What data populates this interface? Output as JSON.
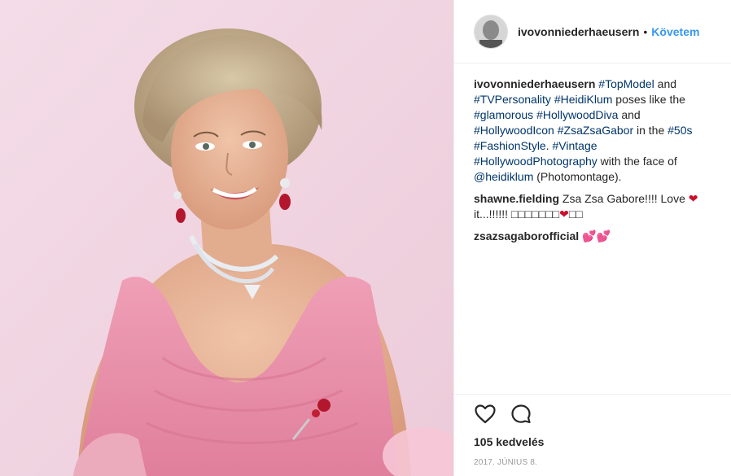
{
  "header": {
    "username": "ivovonniederhaeusern",
    "separator": "•",
    "follow_label": "Követem"
  },
  "caption": {
    "username": "ivovonniederhaeusern",
    "parts": [
      {
        "type": "tag",
        "text": "#TopModel"
      },
      {
        "type": "text",
        "text": " and "
      },
      {
        "type": "tag",
        "text": "#TVPersonality"
      },
      {
        "type": "text",
        "text": " "
      },
      {
        "type": "tag",
        "text": "#HeidiKlum"
      },
      {
        "type": "text",
        "text": " poses like the "
      },
      {
        "type": "tag",
        "text": "#glamorous"
      },
      {
        "type": "text",
        "text": " "
      },
      {
        "type": "tag",
        "text": "#HollywoodDiva"
      },
      {
        "type": "text",
        "text": " and "
      },
      {
        "type": "tag",
        "text": "#HollywoodIcon"
      },
      {
        "type": "text",
        "text": " "
      },
      {
        "type": "tag",
        "text": "#ZsaZsaGabor"
      },
      {
        "type": "text",
        "text": " in the "
      },
      {
        "type": "tag",
        "text": "#50s"
      },
      {
        "type": "text",
        "text": " "
      },
      {
        "type": "tag",
        "text": "#FashionStyle"
      },
      {
        "type": "text",
        "text": ". "
      },
      {
        "type": "tag",
        "text": "#Vintage"
      },
      {
        "type": "text",
        "text": " "
      },
      {
        "type": "tag",
        "text": "#HollywoodPhotography"
      },
      {
        "type": "text",
        "text": " with the face of "
      },
      {
        "type": "tag",
        "text": "@heidiklum"
      },
      {
        "type": "text",
        "text": " (Photomontage)."
      }
    ]
  },
  "comments": [
    {
      "username": "shawne.fielding",
      "text_before": "Zsa Zsa Gabore!!!! Love ",
      "heart": "❤",
      "text_after": " it...!!!!!! □□□□□□□",
      "heart2": "❤",
      "text_end": "□□"
    },
    {
      "username": "zsazsagaborofficial",
      "emoji": "💕💕"
    }
  ],
  "actions": {
    "like_icon": "heart-outline-icon",
    "comment_icon": "comment-bubble-icon",
    "likes_text": "105 kedvelés",
    "date_text": "2017. JÚNIUS 8."
  },
  "colors": {
    "link": "#003569",
    "follow": "#3897f0",
    "photo_bg": "#f1d3e0",
    "dress": "#e89ab0"
  }
}
